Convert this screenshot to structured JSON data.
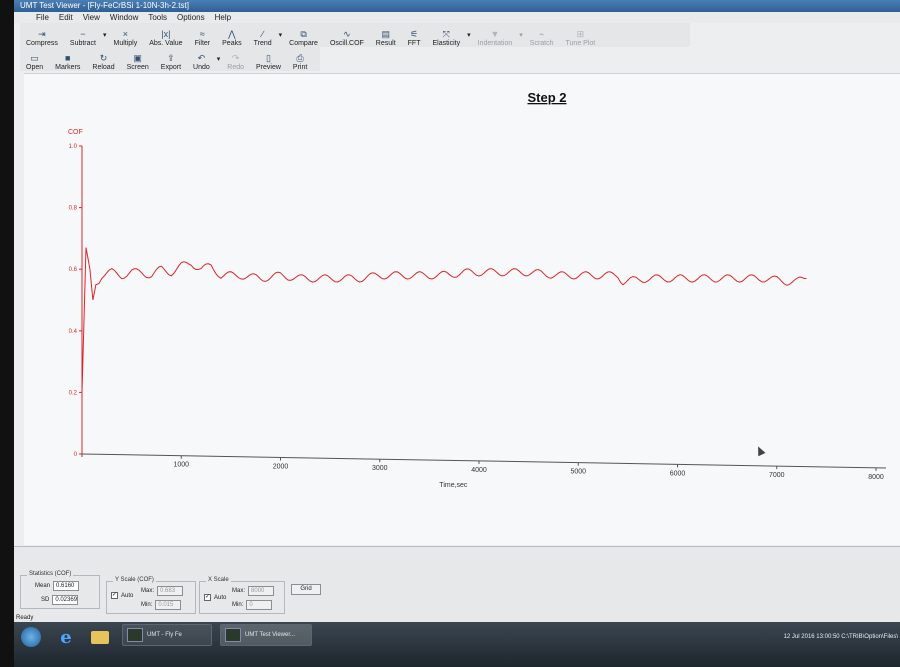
{
  "window": {
    "title": "UMT Test Viewer - [Fly-FeCrBSi 1-10N-3h-2.tst]"
  },
  "menu": [
    "File",
    "Edit",
    "View",
    "Window",
    "Tools",
    "Options",
    "Help"
  ],
  "toolbar1": [
    {
      "label": "Compress",
      "icon": "compress-icon",
      "enabled": true
    },
    {
      "label": "Subtract",
      "icon": "subtract-icon",
      "enabled": true,
      "dropdown": true
    },
    {
      "label": "Multiply",
      "icon": "multiply-icon",
      "enabled": true
    },
    {
      "label": "Abs. Value",
      "icon": "abs-value-icon",
      "enabled": true
    },
    {
      "label": "Filter",
      "icon": "filter-icon",
      "enabled": true
    },
    {
      "label": "Peaks",
      "icon": "peaks-icon",
      "enabled": true
    },
    {
      "label": "Trend",
      "icon": "trend-icon",
      "enabled": true,
      "dropdown": true
    },
    {
      "label": "Compare",
      "icon": "compare-icon",
      "enabled": true
    },
    {
      "label": "Oscill.COF",
      "icon": "oscill-icon",
      "enabled": true
    },
    {
      "label": "Result",
      "icon": "result-icon",
      "enabled": true
    },
    {
      "label": "FFT",
      "icon": "fft-icon",
      "enabled": true
    },
    {
      "label": "Elasticity",
      "icon": "elasticity-icon",
      "enabled": true,
      "dropdown": true
    },
    {
      "label": "Indentation",
      "icon": "indentation-icon",
      "enabled": false,
      "dropdown": true
    },
    {
      "label": "Scratch",
      "icon": "scratch-icon",
      "enabled": false
    },
    {
      "label": "Tune Plot",
      "icon": "tune-plot-icon",
      "enabled": false
    }
  ],
  "toolbar2": [
    {
      "label": "Open",
      "icon": "open-folder-icon",
      "enabled": true
    },
    {
      "label": "Markers",
      "icon": "markers-icon",
      "enabled": true
    },
    {
      "label": "Reload",
      "icon": "reload-icon",
      "enabled": true
    },
    {
      "label": "Screen",
      "icon": "screen-icon",
      "enabled": true
    },
    {
      "label": "Export",
      "icon": "export-icon",
      "enabled": true
    },
    {
      "label": "Undo",
      "icon": "undo-icon",
      "enabled": true,
      "dropdown": true
    },
    {
      "label": "Redo",
      "icon": "redo-icon",
      "enabled": false
    },
    {
      "label": "Preview",
      "icon": "preview-icon",
      "enabled": true
    },
    {
      "label": "Print",
      "icon": "print-icon",
      "enabled": true
    }
  ],
  "chart_data": {
    "type": "line",
    "title": "Step 2",
    "ylabel": "COF",
    "xlabel": "Time,sec",
    "xlim": [
      0,
      8000
    ],
    "ylim": [
      0,
      1.0
    ],
    "xticks": [
      0,
      1000,
      2000,
      3000,
      4000,
      5000,
      6000,
      7000,
      8000
    ],
    "yticks": [
      0,
      0.2,
      0.4,
      0.6,
      0.8,
      1.0
    ],
    "ytick_labels": [
      "0",
      "0.2",
      "0.4",
      "0.6",
      "0.8",
      "1.0"
    ],
    "grid": false,
    "line_color": "#d8262b",
    "series": [
      {
        "x": [
          0,
          40,
          80,
          110,
          140,
          200,
          300,
          400,
          500,
          600,
          700,
          800,
          900,
          1000,
          1100,
          1200,
          1300,
          1400,
          1600,
          1800,
          2000,
          2200,
          2500,
          2800,
          3000,
          3300,
          3600,
          3900,
          4200,
          4500,
          4800,
          5000,
          5300,
          5400,
          5450,
          5700,
          6000,
          6300,
          6600,
          6900,
          7100,
          7200,
          7300
        ],
        "y": [
          0.2,
          0.67,
          0.6,
          0.5,
          0.55,
          0.58,
          0.59,
          0.58,
          0.59,
          0.59,
          0.58,
          0.6,
          0.59,
          0.61,
          0.62,
          0.6,
          0.61,
          0.58,
          0.58,
          0.57,
          0.58,
          0.57,
          0.57,
          0.57,
          0.58,
          0.58,
          0.58,
          0.59,
          0.59,
          0.59,
          0.58,
          0.58,
          0.58,
          0.58,
          0.56,
          0.57,
          0.57,
          0.57,
          0.57,
          0.57,
          0.56,
          0.56,
          0.57
        ]
      }
    ]
  },
  "stats": {
    "group_title": "Statistics (COF)",
    "mean_label": "Mean",
    "mean_value": "0.6160",
    "sd_label": "SD",
    "sd_value": "0.02369"
  },
  "yscale": {
    "group_title": "Y Scale (COF)",
    "auto_label": "Auto",
    "auto_checked": true,
    "max_label": "Max:",
    "max_value": "0.683",
    "min_label": "Min:",
    "min_value": "0.015"
  },
  "xscale": {
    "group_title": "X Scale",
    "auto_label": "Auto",
    "auto_checked": true,
    "max_label": "Max:",
    "max_value": "8000",
    "min_label": "Min:",
    "min_value": "0"
  },
  "grid_button": "Grid",
  "status_text": "Ready",
  "taskbar": {
    "task1_label": "UMT - Fly Fe",
    "task2_label": "UMT Test Viewer...",
    "clock_text": "12 Jul 2016 13:00:50  C:\\TRIB\\Option\\Files\\"
  }
}
